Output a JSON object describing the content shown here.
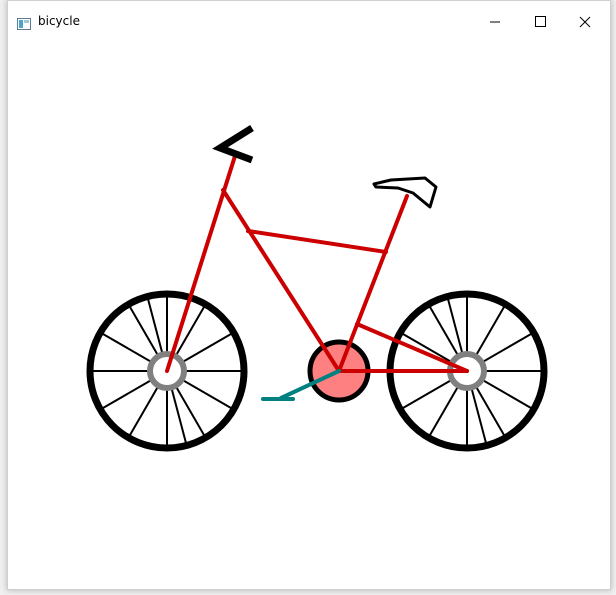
{
  "window": {
    "title": "bicycle",
    "icon": "window-app-icon",
    "controls": [
      "minimize-icon",
      "maximize-icon",
      "close-icon"
    ]
  },
  "drawing": {
    "subject": "bicycle",
    "colors": {
      "frame": "#cc0000",
      "tire": "#000000",
      "hub": "#808080",
      "chainring_fill": "#ff8080",
      "pedal_crank": "#008080",
      "saddle": "#ffffff",
      "handlebar": "#000000"
    }
  }
}
